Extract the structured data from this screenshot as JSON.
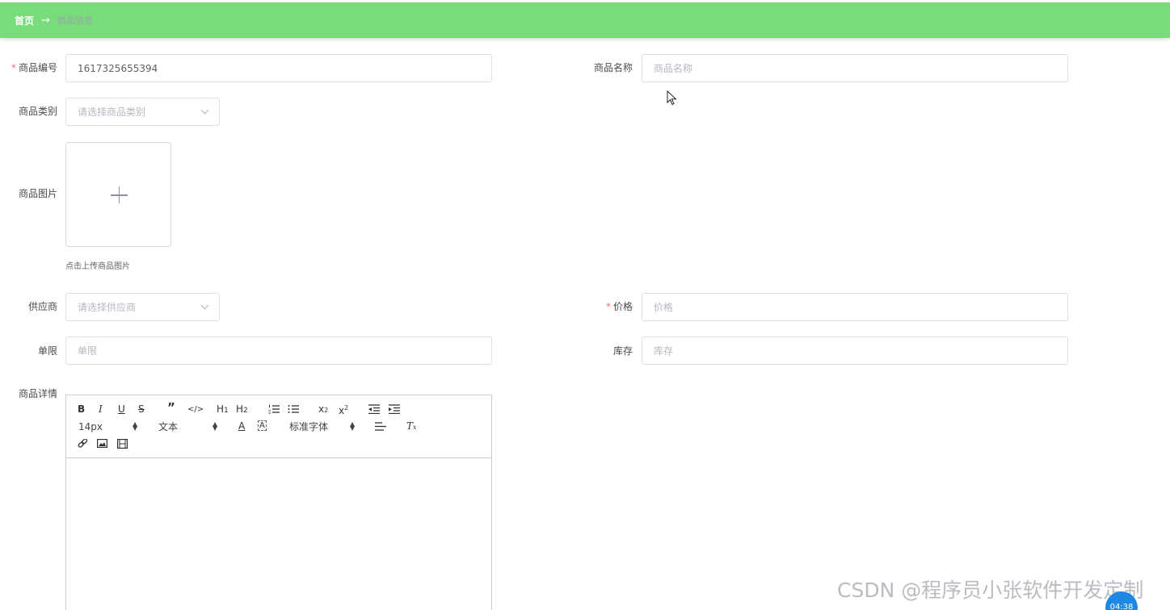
{
  "breadcrumb": {
    "home": "首页",
    "separator": "→",
    "current": "商品信息"
  },
  "form": {
    "goods_no": {
      "label": "商品编号",
      "required": true,
      "value": "1617325655394"
    },
    "goods_name": {
      "label": "商品名称",
      "placeholder": "商品名称"
    },
    "category": {
      "label": "商品类别",
      "placeholder": "请选择商品类别"
    },
    "image": {
      "label": "商品图片",
      "tip": "点击上传商品图片"
    },
    "supplier": {
      "label": "供应商",
      "placeholder": "请选择供应商"
    },
    "price": {
      "label": "价格",
      "required": true,
      "placeholder": "价格"
    },
    "limit": {
      "label": "单限",
      "placeholder": "单限"
    },
    "stock": {
      "label": "库存",
      "placeholder": "库存"
    },
    "detail": {
      "label": "商品详情"
    }
  },
  "editor": {
    "font_size": "14px",
    "header_picker": "文本",
    "font_family": "标准字体",
    "tools": [
      "bold-icon",
      "italic-icon",
      "underline-icon",
      "strike-icon",
      "blockquote-icon",
      "code-block-icon",
      "header1-icon",
      "header2-icon",
      "ordered-list-icon",
      "bullet-list-icon",
      "subscript-icon",
      "superscript-icon",
      "outdent-icon",
      "indent-icon",
      "text-color-icon",
      "background-color-icon",
      "align-icon",
      "clean-format-icon",
      "link-icon",
      "image-icon",
      "video-icon"
    ]
  },
  "watermark": "CSDN @程序员小张软件开发定制",
  "timer": "04:38",
  "colors": {
    "header_bg": "#78dc7c",
    "required": "#f56c6c",
    "border": "#dcdfe6",
    "placeholder": "#b4b8bf"
  }
}
